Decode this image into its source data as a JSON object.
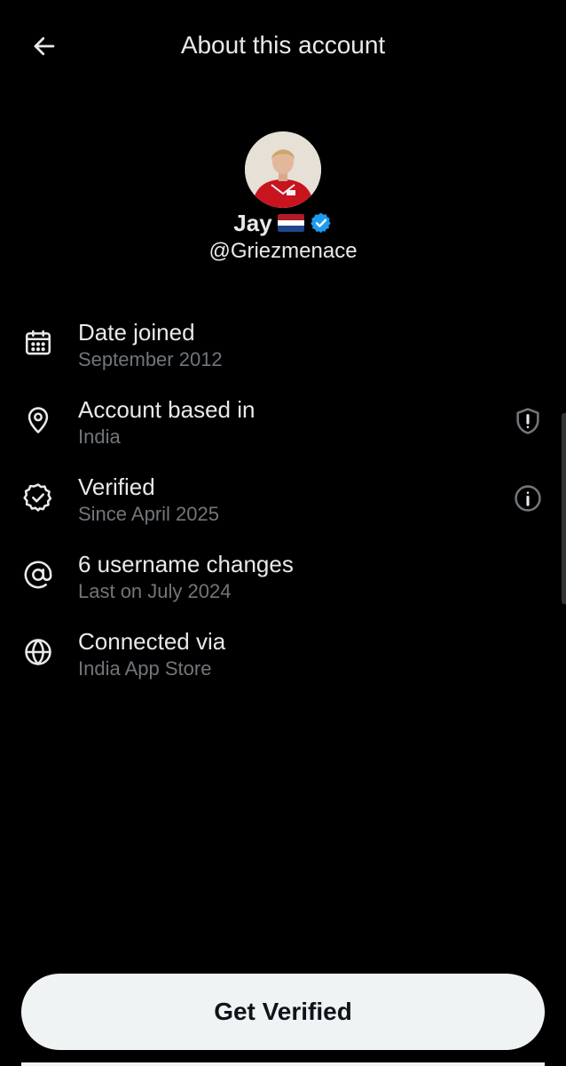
{
  "header": {
    "back_icon": "arrow-left-icon",
    "title": "About this account"
  },
  "profile": {
    "avatar_icon": "profile-photo",
    "display_name": "Jay",
    "flag_icon": "netherlands-flag-icon",
    "verified_icon": "verified-badge-icon",
    "verified_color": "#1d9bf0",
    "handle": "@Griezmenace"
  },
  "info": [
    {
      "icon": "calendar-icon",
      "label": "Date joined",
      "sub": "September 2012"
    },
    {
      "icon": "location-pin-icon",
      "label": "Account based in",
      "sub": "India",
      "action_icon": "shield-alert-icon"
    },
    {
      "icon": "verified-check-icon",
      "label": "Verified",
      "sub": "Since April 2025",
      "action_icon": "info-icon"
    },
    {
      "icon": "at-sign-icon",
      "label": "6 username changes",
      "sub": "Last on July 2024"
    },
    {
      "icon": "globe-icon",
      "label": "Connected via",
      "sub": "India App Store"
    }
  ],
  "cta": {
    "label": "Get Verified"
  },
  "colors": {
    "background": "#000000",
    "primary_text": "#e7e9ea",
    "secondary_text": "#71767b",
    "button_bg": "#eff3f4",
    "button_text": "#0f1419"
  }
}
